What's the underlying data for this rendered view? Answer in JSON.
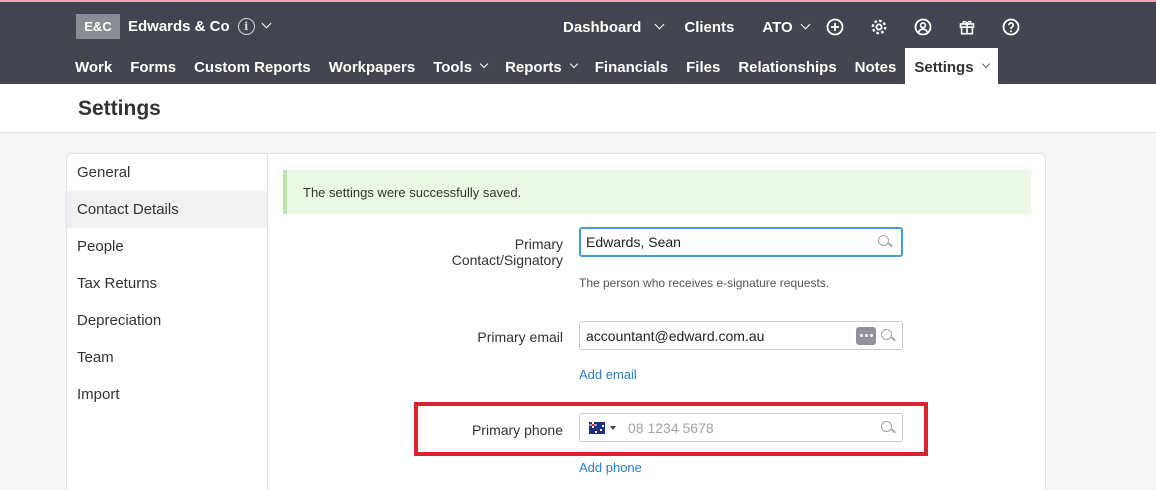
{
  "brand": {
    "logo": "E&C",
    "name": "Edwards & Co",
    "info_icon": "info-icon"
  },
  "top_links": {
    "dashboard": "Dashboard",
    "clients": "Clients",
    "ato": "ATO"
  },
  "top_icons": [
    "plus-circle-icon",
    "gear-icon",
    "user-circle-icon",
    "gift-icon",
    "help-icon"
  ],
  "nav": {
    "work": "Work",
    "forms": "Forms",
    "custom_reports": "Custom Reports",
    "workpapers": "Workpapers",
    "tools": "Tools",
    "reports": "Reports",
    "financials": "Financials",
    "files": "Files",
    "relationships": "Relationships",
    "notes": "Notes",
    "settings": "Settings"
  },
  "page": {
    "title": "Settings"
  },
  "sidebar": {
    "items": [
      {
        "label": "General"
      },
      {
        "label": "Contact Details"
      },
      {
        "label": "People"
      },
      {
        "label": "Tax Returns"
      },
      {
        "label": "Depreciation"
      },
      {
        "label": "Team"
      },
      {
        "label": "Import"
      }
    ]
  },
  "alert": {
    "message": "The settings were successfully saved."
  },
  "form": {
    "primary_contact": {
      "label_line1": "Primary",
      "label_line2": "Contact/Signatory",
      "value": "Edwards, Sean",
      "help": "The person who receives e-signature requests."
    },
    "primary_email": {
      "label": "Primary email",
      "value": "accountant@edward.com.au",
      "add_link": "Add email"
    },
    "primary_phone": {
      "label": "Primary phone",
      "placeholder": "08 1234 5678",
      "add_link": "Add phone"
    }
  },
  "colors": {
    "topbar": "#424450",
    "link": "#2a7cc7",
    "highlight": "#d9232d",
    "alert_bg": "#e9f9e3"
  }
}
